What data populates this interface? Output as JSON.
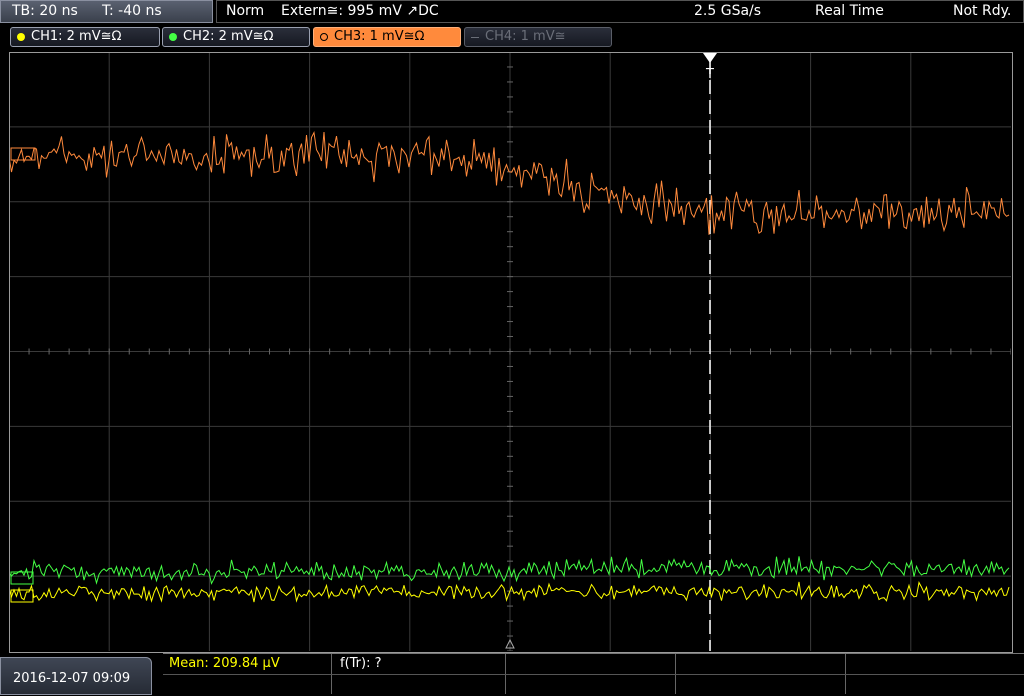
{
  "topbar": {
    "timebase": "TB: 20 ns",
    "trigger_offset": "T: -40 ns",
    "trigger_mode": "Norm",
    "trigger_source": "Extern≅: 995 mV ↗DC",
    "sample_rate": "2.5 GSa/s",
    "acquisition_mode": "Real Time",
    "status": "Not Rdy."
  },
  "channels": [
    {
      "label": "CH1: 2 mV≅Ω",
      "color": "#ffff00",
      "state": "on"
    },
    {
      "label": "CH2: 2 mV≅Ω",
      "color": "#44ff44",
      "state": "on"
    },
    {
      "label": "CH3: 1 mV≅Ω",
      "color": "#ff8a3c",
      "state": "active"
    },
    {
      "label": "CH4: 1 mV≅",
      "color": "#6a6e78",
      "state": "off"
    }
  ],
  "trigger_marker": "T",
  "bottombar": {
    "datetime": "2016-12-07 09:09",
    "measurement_mean": "Mean: 209.84 µV",
    "measurement_ftr": "f(Tr): ?"
  },
  "colors": {
    "ch1": "#ffff00",
    "ch2": "#44ff44",
    "ch3": "#ff8a3c",
    "grid": "#3a3a3a"
  }
}
